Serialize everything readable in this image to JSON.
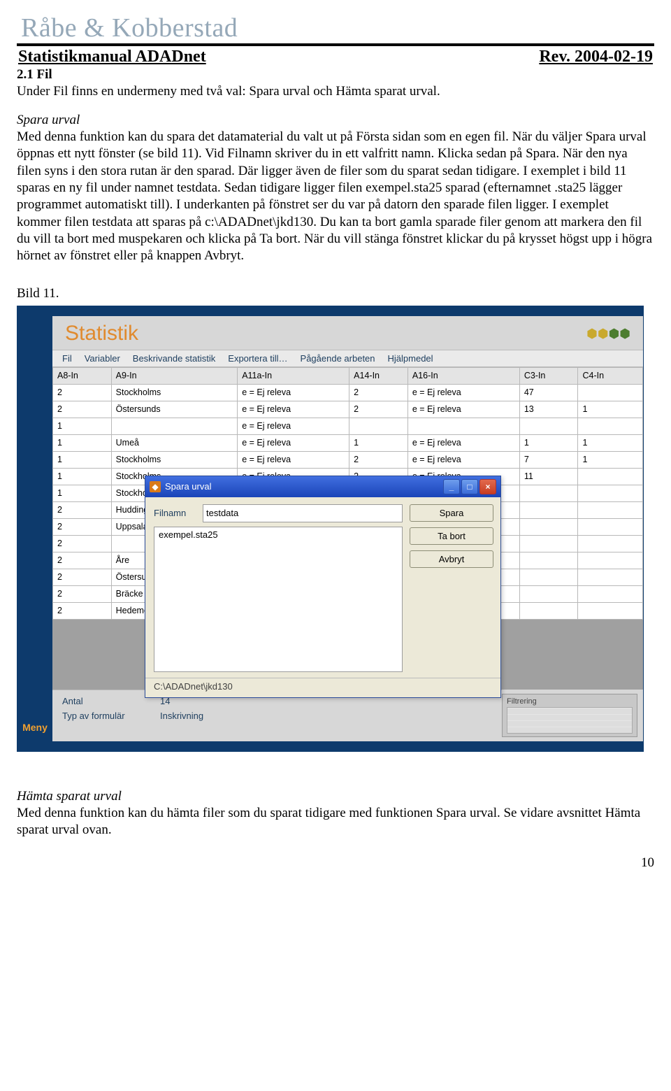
{
  "doc": {
    "brand": "Råbe & Kobberstad",
    "title": "Statistikmanual ADADnet",
    "rev": "Rev. 2004-02-19",
    "page_number": "10",
    "section_heading": "2.1 Fil",
    "intro_line": "Under Fil finns en undermeny med två val: Spara urval och Hämta sparat urval.",
    "spara_urval_heading": "Spara urval",
    "spara_urval_body": "Med denna funktion kan du spara det datamaterial du valt ut på Första sidan som en egen fil. När du väljer Spara urval öppnas ett nytt fönster (se bild 11). Vid Filnamn skriver du in ett valfritt namn. Klicka sedan på Spara. När den nya filen syns i den stora rutan är den sparad. Där ligger även de filer som du sparat sedan tidigare. I exemplet i bild 11 sparas en ny fil under namnet testdata. Sedan tidigare ligger filen exempel.sta25 sparad (efternamnet .sta25 lägger programmet automatiskt till). I underkanten på fönstret ser du var på datorn den sparade filen ligger. I exemplet kommer filen testdata att sparas på c:\\ADADnet\\jkd130. Du kan ta bort gamla sparade filer genom att markera den fil du vill ta bort med muspekaren och klicka på Ta bort. När du vill stänga fönstret klickar du på krysset högst upp i högra hörnet av fönstret eller på knappen Avbryt.",
    "caption": "Bild 11.",
    "hamta_heading": "Hämta sparat urval",
    "hamta_body": "Med denna funktion kan du hämta filer som du sparat tidigare med funktionen Spara urval. Se vidare avsnittet Hämta sparat urval ovan."
  },
  "shot": {
    "title": "Statistik",
    "sidebar_tab": "Meny",
    "menubar": [
      "Fil",
      "Variabler",
      "Beskrivande statistik",
      "Exportera till…",
      "Pågående arbeten",
      "Hjälpmedel"
    ],
    "columns": [
      "A8-In",
      "A9-In",
      "A11a-In",
      "A14-In",
      "A16-In",
      "C3-In",
      "C4-In"
    ],
    "rows": [
      [
        "2",
        "Stockholms",
        "e = Ej releva",
        "2",
        "e = Ej releva",
        "47",
        ""
      ],
      [
        "2",
        "Östersunds",
        "e = Ej releva",
        "2",
        "e = Ej releva",
        "13",
        "1"
      ],
      [
        "1",
        "",
        "e = Ej releva",
        "",
        "",
        "",
        ""
      ],
      [
        "1",
        "Umeå",
        "e = Ej releva",
        "1",
        "e = Ej releva",
        "1",
        "1"
      ],
      [
        "1",
        "Stockholms",
        "e = Ej releva",
        "2",
        "e = Ej releva",
        "7",
        "1"
      ],
      [
        "1",
        "Stockholms",
        "e = Ej releva",
        "2",
        "e = Ej releva",
        "11",
        ""
      ],
      [
        "1",
        "Stockholms",
        "",
        "",
        "",
        "",
        ""
      ],
      [
        "2",
        "Huddinge",
        "",
        "",
        "",
        "",
        ""
      ],
      [
        "2",
        "Uppsala",
        "",
        "",
        "",
        "",
        ""
      ],
      [
        "2",
        "",
        "",
        "",
        "",
        "",
        ""
      ],
      [
        "2",
        "Åre",
        "",
        "",
        "",
        "",
        ""
      ],
      [
        "2",
        "Östersunds",
        "",
        "",
        "",
        "",
        ""
      ],
      [
        "2",
        "Bräcke",
        "",
        "",
        "",
        "",
        ""
      ],
      [
        "2",
        "Hedemora",
        "",
        "",
        "",
        "",
        ""
      ]
    ],
    "dialog": {
      "title": "Spara urval",
      "filnamn_label": "Filnamn",
      "filnamn_value": "testdata",
      "list_item": "exempel.sta25",
      "btn_spara": "Spara",
      "btn_tabort": "Ta bort",
      "btn_avbryt": "Avbryt",
      "path": "C:\\ADADnet\\jkd130"
    },
    "status": {
      "antal_label": "Antal",
      "antal_value": "14",
      "typ_label": "Typ av formulär",
      "typ_value": "Inskrivning",
      "filtrering_label": "Filtrering"
    }
  }
}
